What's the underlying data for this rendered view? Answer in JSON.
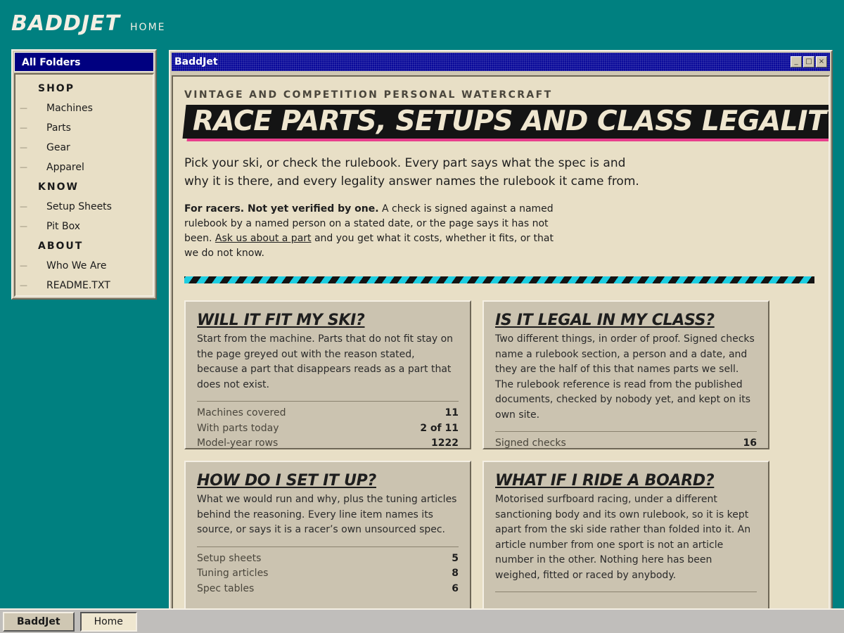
{
  "header": {
    "brand": "BADDJET",
    "home_link": "HOME"
  },
  "sidebar": {
    "title": "All Folders",
    "groups": [
      {
        "label": "SHOP",
        "items": [
          "Machines",
          "Parts",
          "Gear",
          "Apparel"
        ]
      },
      {
        "label": "KNOW",
        "items": [
          "Setup Sheets",
          "Pit Box"
        ]
      },
      {
        "label": "ABOUT",
        "items": [
          "Who We Are",
          "README.TXT"
        ]
      }
    ]
  },
  "window": {
    "title": "BaddJet",
    "controls": {
      "minimize": "_",
      "maximize": "□",
      "close": "×"
    }
  },
  "main": {
    "eyebrow": "VINTAGE AND COMPETITION PERSONAL WATERCRAFT",
    "hero": "RACE PARTS, SETUPS AND CLASS LEGALITY",
    "lede": "Pick your ski, or check the rulebook. Every part says what the spec is and why it is there, and every legality answer names the rulebook it came from.",
    "note": {
      "bold": "For racers. Not yet verified by one.",
      "text1": " A check is signed against a named rulebook by a named person on a stated date, or the page says it has not been. ",
      "link": "Ask us about a part",
      "text2": " and you get what it costs, whether it fits, or that we do not know."
    },
    "cards": [
      {
        "title": "WILL IT FIT MY SKI?",
        "body": "Start from the machine. Parts that do not fit stay on the page greyed out with the reason stated, because a part that disappears reads as a part that does not exist.",
        "stats": [
          {
            "label": "Machines covered",
            "value": "11"
          },
          {
            "label": "With parts today",
            "value": "2 of 11"
          },
          {
            "label": "Model-year rows",
            "value": "1222"
          }
        ]
      },
      {
        "title": "IS IT LEGAL IN MY CLASS?",
        "body": "Two different things, in order of proof. Signed checks name a rulebook section, a person and a date, and they are the half of this that names parts we sell. The rulebook reference is read from the published documents, checked by nobody yet, and kept on its own site.",
        "stats": [
          {
            "label": "Signed checks",
            "value": "16"
          }
        ]
      },
      {
        "title": "HOW DO I SET IT UP?",
        "body": "What we would run and why, plus the tuning articles behind the reasoning. Every line item names its source, or says it is a racer’s own unsourced spec.",
        "stats": [
          {
            "label": "Setup sheets",
            "value": "5"
          },
          {
            "label": "Tuning articles",
            "value": "8"
          },
          {
            "label": "Spec tables",
            "value": "6"
          }
        ]
      },
      {
        "title": "WHAT IF I RIDE A BOARD?",
        "body": "Motorised surfboard racing, under a different sanctioning body and its own rulebook, so it is kept apart from the ski side rather than folded into it. An article number from one sport is not an article number in the other. Nothing here has been weighed, fitted or raced by anybody.",
        "stats": []
      }
    ]
  },
  "taskbar": {
    "start": "BaddJet",
    "task": "Home"
  }
}
